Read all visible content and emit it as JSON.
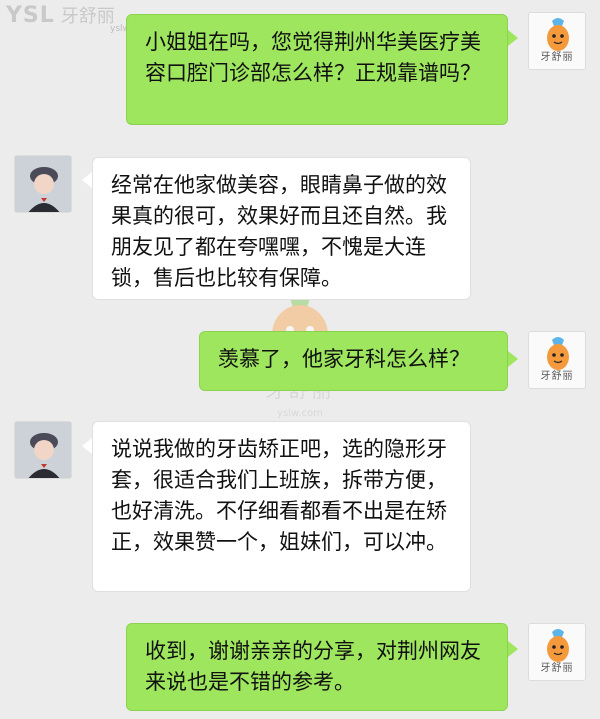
{
  "watermark": {
    "corner_text": "YSL",
    "corner_cn": "牙舒丽",
    "corner_url": "yslw.com",
    "center_cn": "牙舒丽",
    "center_url": "yslw.com"
  },
  "brand_avatar_label": "牙舒丽",
  "messages": [
    {
      "side": "sent",
      "text": "小姐姐在吗，您觉得荆州华美医疗美容口腔门诊部怎么样？正规靠谱吗？"
    },
    {
      "side": "recv",
      "text": "经常在他家做美容，眼睛鼻子做的效果真的很可，效果好而且还自然。我朋友见了都在夸嘿嘿，不愧是大连锁，售后也比较有保障。"
    },
    {
      "side": "sent",
      "text": "羡慕了，他家牙科怎么样？"
    },
    {
      "side": "recv",
      "text": "说说我做的牙齿矫正吧，选的隐形牙套，很适合我们上班族，拆带方便，也好清洗。不仔细看都看不出是在矫正，效果赞一个，姐妹们，可以冲。"
    },
    {
      "side": "sent",
      "text": "收到，谢谢亲亲的分享，对荆州网友来说也是不错的参考。"
    }
  ],
  "colors": {
    "sent_bubble": "#9ee65e",
    "recv_bubble": "#ffffff",
    "background": "#ececec"
  }
}
